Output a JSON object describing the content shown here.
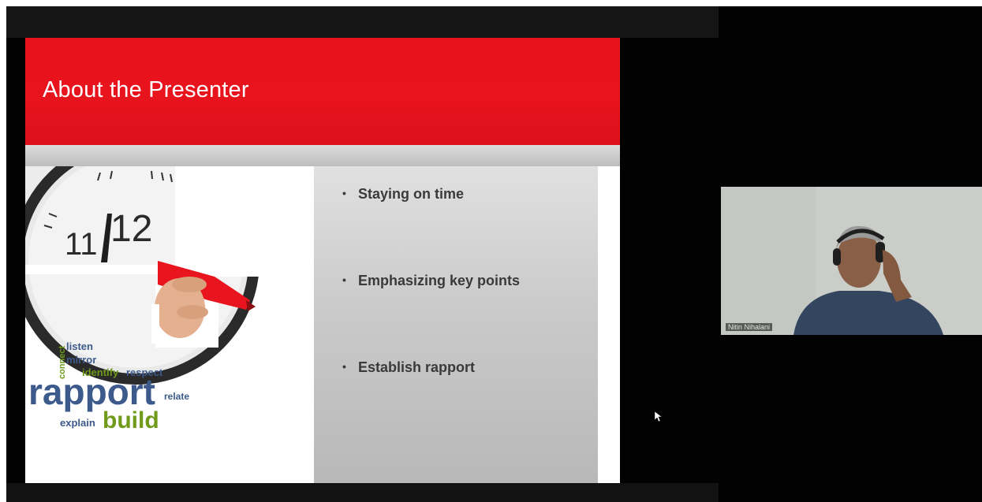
{
  "slide": {
    "title": "About the Presenter",
    "bullet_glyph": "•",
    "bullets": [
      "Staying on time",
      "Emphasizing key points",
      "Establish rapport"
    ],
    "clock_numbers": [
      "11",
      "12"
    ],
    "word_cloud": {
      "rapport": "rapport",
      "build": "build",
      "explain": "explain",
      "listen": "listen",
      "mirror": "mirror",
      "identify": "identify",
      "respect": "respect",
      "relate": "relate",
      "connect": "connect"
    }
  },
  "video": {
    "participant_name": "Nitin Nihalani"
  },
  "colors": {
    "header_red": "#e7131d",
    "bullet_text": "#3a3a3a",
    "word_blue": "#3d5a8c",
    "word_green": "#6f9a1a"
  }
}
